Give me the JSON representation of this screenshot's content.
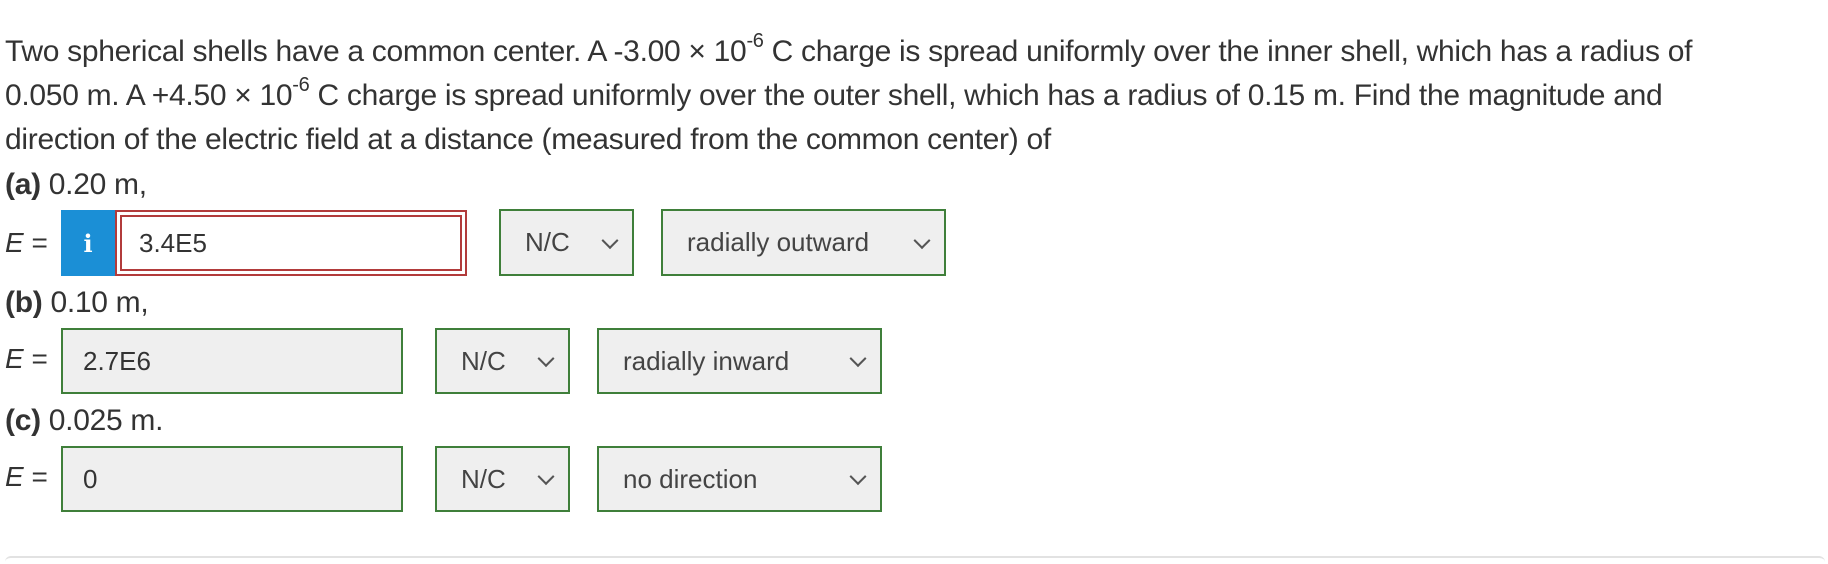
{
  "problem": {
    "line1_a": "Two spherical shells have a common center. A -3.00 × 10",
    "line1_exp": "-6",
    "line1_b": " C charge is spread uniformly over the inner shell, which has a radius of",
    "line2_a": "0.050 m. A +4.50 × 10",
    "line2_exp": "-6",
    "line2_b": " C charge is spread uniformly over the outer shell, which has a radius of 0.15 m. Find the magnitude and",
    "line3": "direction of the electric field at a distance (measured from the common center) of"
  },
  "parts": [
    {
      "label": "(a)",
      "text": " 0.20 m,",
      "e_label": "E",
      "eq": " =",
      "info_icon": "i",
      "answer": "3.4E5",
      "answer_status": "incorrect",
      "unit": "N/C",
      "direction": "radially outward"
    },
    {
      "label": "(b)",
      "text": " 0.10 m,",
      "e_label": "E",
      "eq": " =",
      "answer": "2.7E6",
      "answer_status": "correct",
      "unit": "N/C",
      "direction": "radially inward"
    },
    {
      "label": "(c)",
      "text": " 0.025 m.",
      "e_label": "E",
      "eq": " =",
      "answer": "0",
      "answer_status": "correct",
      "unit": "N/C",
      "direction": "no direction"
    }
  ],
  "colors": {
    "correct_border": "#3f7f3a",
    "incorrect_border": "#b23b3b",
    "info_button": "#1b8fd6",
    "field_background": "#efefef"
  },
  "icons": {
    "info": "info-icon",
    "dropdown": "chevron-down-icon"
  }
}
